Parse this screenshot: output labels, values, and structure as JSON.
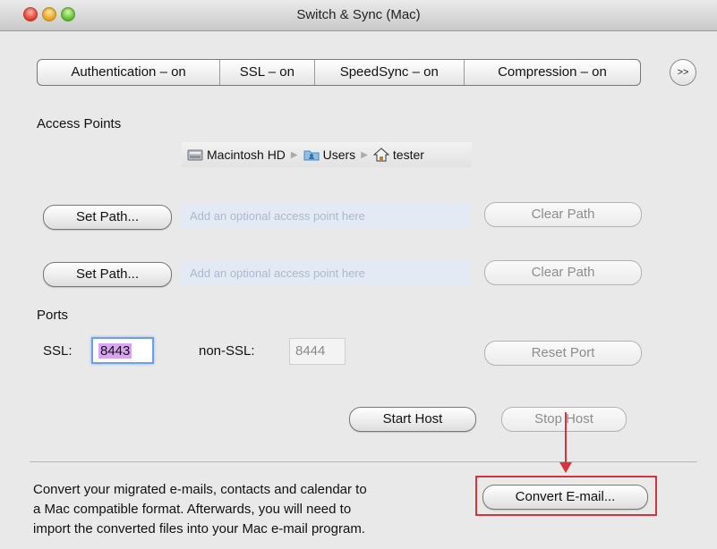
{
  "window": {
    "title": "Switch & Sync (Mac)"
  },
  "settings_bar": {
    "segments": [
      "Authentication – on",
      "SSL – on",
      "SpeedSync – on",
      "Compression – on"
    ],
    "more_label": ">>"
  },
  "access_points": {
    "heading": "Access Points",
    "breadcrumb": [
      "Macintosh HD",
      "Users",
      "tester"
    ],
    "rows": [
      {
        "set_label": "Set Path...",
        "placeholder": "Add an optional access point here",
        "clear_label": "Clear Path"
      },
      {
        "set_label": "Set Path...",
        "placeholder": "Add an optional access point here",
        "clear_label": "Clear Path"
      }
    ]
  },
  "ports": {
    "heading": "Ports",
    "ssl_label": "SSL:",
    "ssl_value": "8443",
    "nonssl_label": "non-SSL:",
    "nonssl_value": "8444",
    "reset_label": "Reset Port"
  },
  "host": {
    "start_label": "Start Host",
    "stop_label": "Stop Host"
  },
  "convert": {
    "description_lines": [
      "Convert your migrated e-mails, contacts and calendar to",
      "a Mac compatible format. Afterwards, you will need to",
      "import the converted files into your Mac e-mail program."
    ],
    "button_label": "Convert E-mail..."
  },
  "colors": {
    "annotation": "#d8333c",
    "focus_ring": "#6c9ef0",
    "path_field_bg": "#e3eaf4"
  },
  "icons": [
    "hard-drive-icon",
    "folder-users-icon",
    "home-icon",
    "chevron-right-icon"
  ]
}
